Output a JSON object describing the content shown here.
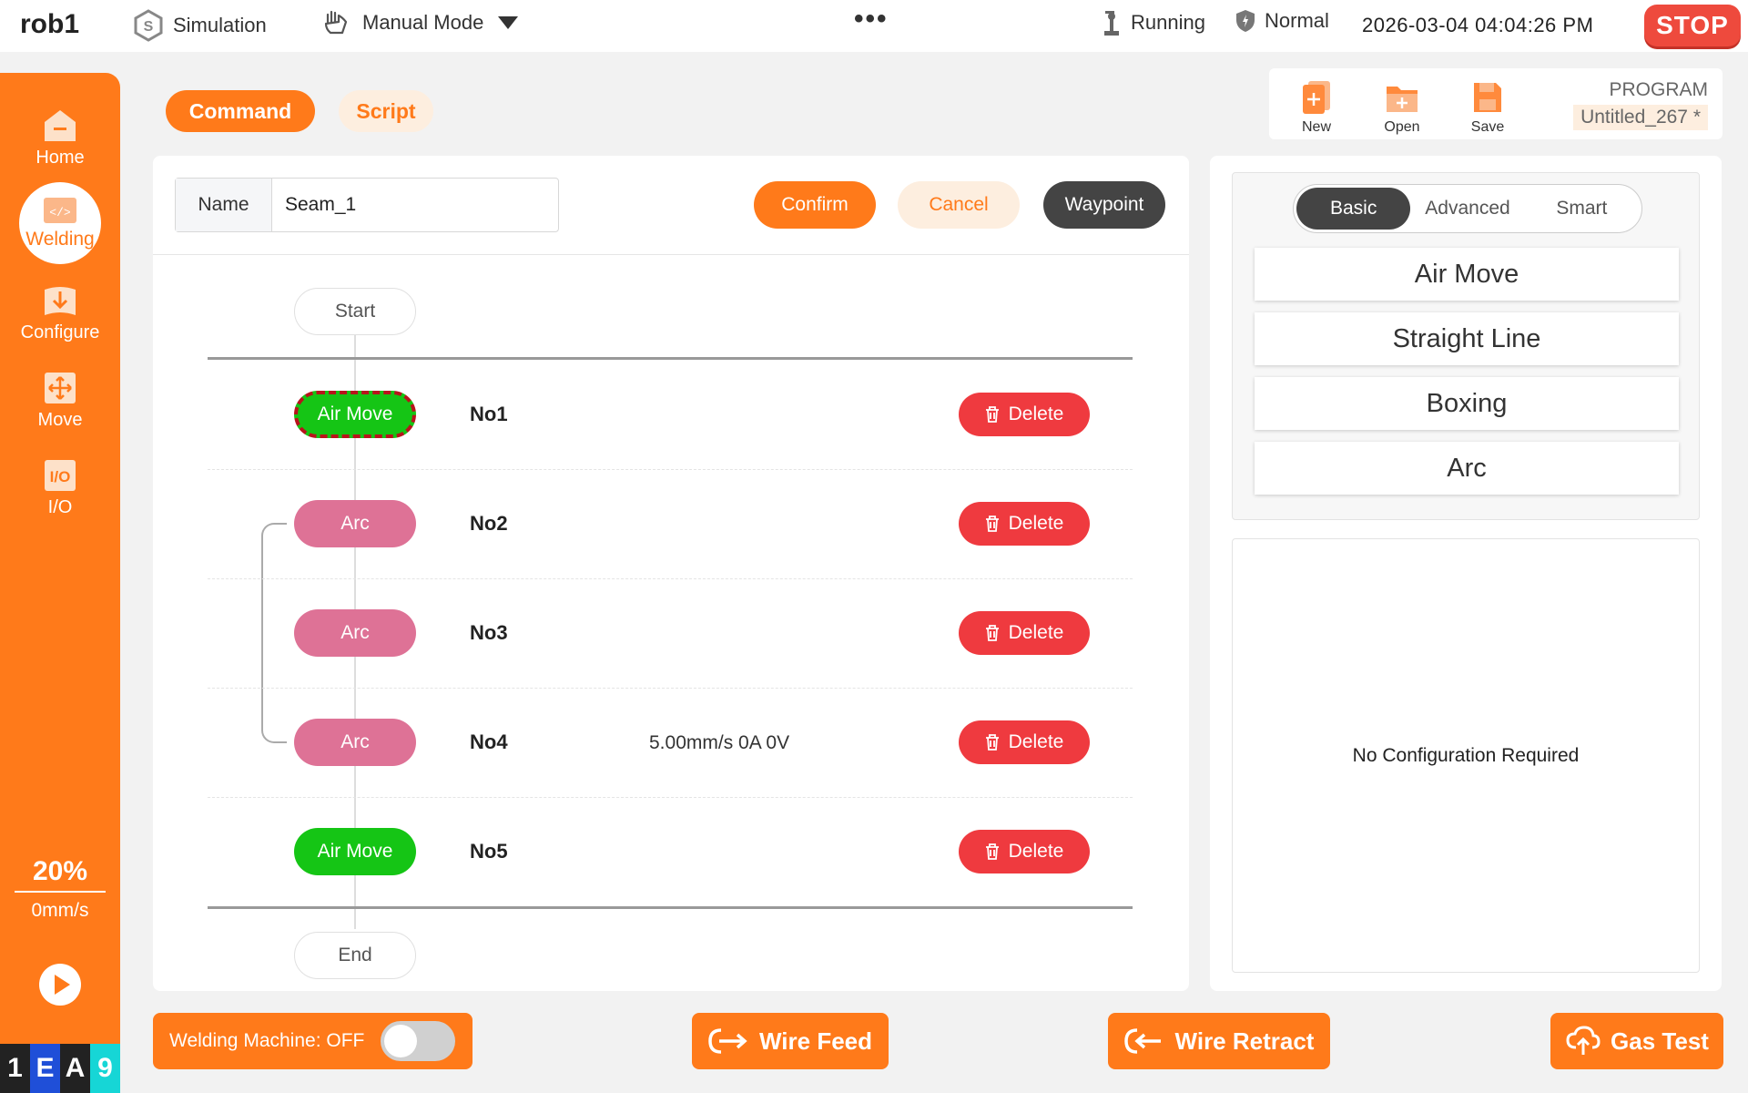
{
  "topbar": {
    "robot_name": "rob1",
    "simulation_label": "Simulation",
    "mode_label": "Manual Mode",
    "more_label": "•••",
    "status_running": "Running",
    "status_normal": "Normal",
    "datetime": "2026-03-04 04:04:26 PM",
    "stop_label": "STOP"
  },
  "sidebar": {
    "items": [
      {
        "label": "Home",
        "icon": "home-icon"
      },
      {
        "label": "Welding",
        "icon": "code-icon"
      },
      {
        "label": "Configure",
        "icon": "download-icon"
      },
      {
        "label": "Move",
        "icon": "move-arrows-icon"
      },
      {
        "label": "I/O",
        "icon": "io-icon"
      }
    ],
    "speed_percent": "20%",
    "speed_value": "0mm/s",
    "badge": [
      "1",
      "E",
      "A",
      "9"
    ]
  },
  "tabs": {
    "command": "Command",
    "script": "Script"
  },
  "program": {
    "new_label": "New",
    "open_label": "Open",
    "save_label": "Save",
    "label": "PROGRAM",
    "name": "Untitled_267 *"
  },
  "editor": {
    "name_label": "Name",
    "name_value": "Seam_1",
    "confirm_label": "Confirm",
    "cancel_label": "Cancel",
    "waypoint_label": "Waypoint",
    "start_label": "Start",
    "end_label": "End",
    "delete_label": "Delete",
    "rows": [
      {
        "type": "Air Move",
        "id": "No1",
        "info": ""
      },
      {
        "type": "Arc",
        "id": "No2",
        "info": ""
      },
      {
        "type": "Arc",
        "id": "No3",
        "info": ""
      },
      {
        "type": "Arc",
        "id": "No4",
        "info": "5.00mm/s 0A 0V"
      },
      {
        "type": "Air Move",
        "id": "No5",
        "info": ""
      }
    ]
  },
  "commands": {
    "tabs": [
      "Basic",
      "Advanced",
      "Smart"
    ],
    "options": [
      "Air Move",
      "Straight Line",
      "Boxing",
      "Arc"
    ],
    "config_message": "No Configuration Required"
  },
  "bottom": {
    "machine_label": "Welding Machine: OFF",
    "wire_feed": "Wire Feed",
    "wire_retract": "Wire Retract",
    "gas_test": "Gas Test"
  },
  "colors": {
    "accent": "#ff7a1a",
    "stop": "#ee4a3d",
    "air_move": "#15c515",
    "arc": "#de7296",
    "delete": "#ef3a3f",
    "dark": "#444444"
  }
}
